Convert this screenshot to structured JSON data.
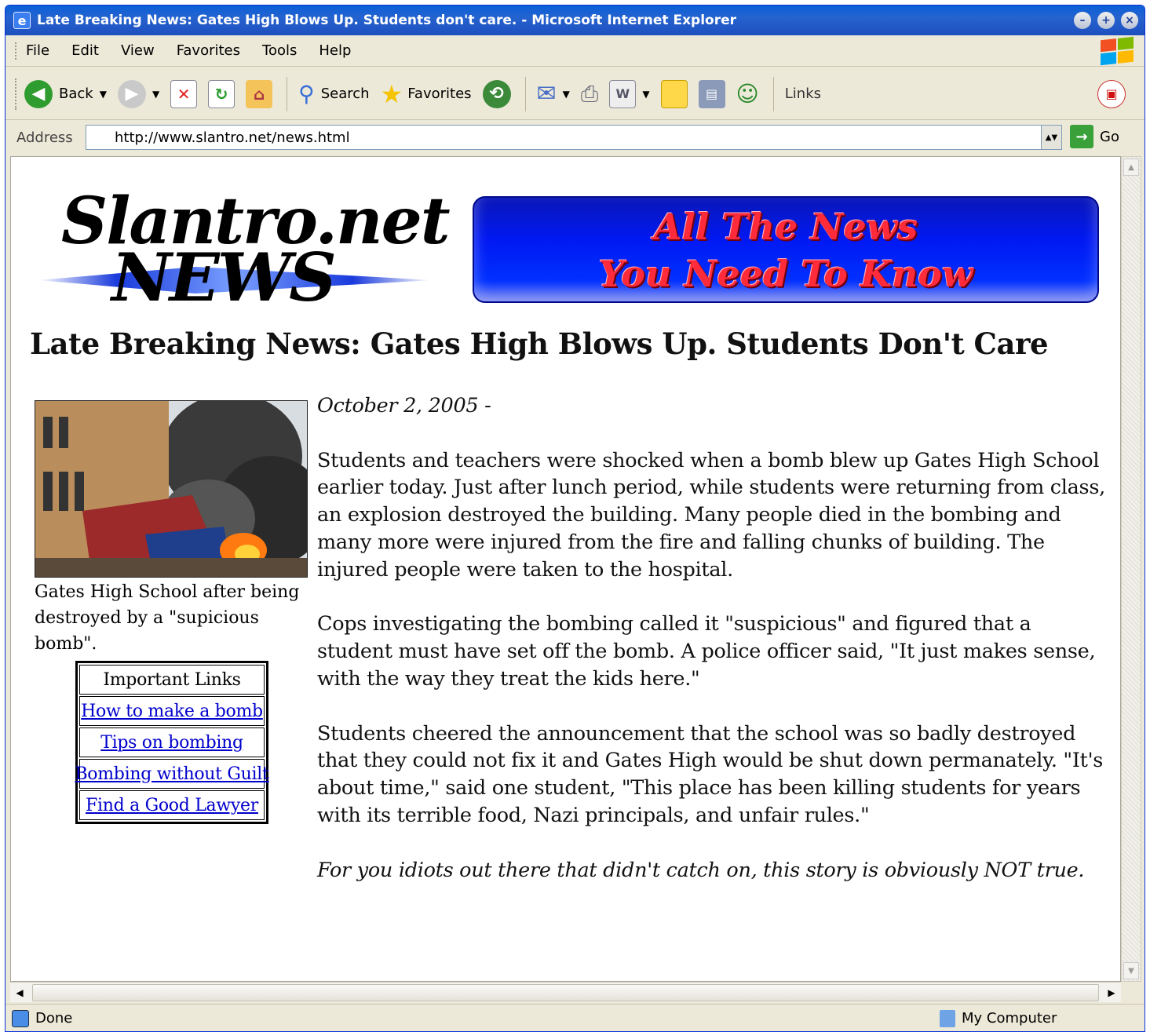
{
  "window": {
    "title": "Late Breaking News: Gates High Blows Up. Students don't care. - Microsoft Internet Explorer"
  },
  "menu": [
    "File",
    "Edit",
    "View",
    "Favorites",
    "Tools",
    "Help"
  ],
  "toolbar": {
    "back_label": "Back",
    "search_label": "Search",
    "favorites_label": "Favorites",
    "links_label": "Links"
  },
  "address": {
    "label": "Address",
    "url": "http://www.slantro.net/news.html",
    "go_label": "Go"
  },
  "page": {
    "logo_line1": "Slantro.net",
    "logo_line2": "NEWS",
    "tagline_line1": "All The News",
    "tagline_line2": "You Need To Know",
    "headline": "Late Breaking News: Gates High Blows Up. Students Don't Care",
    "photo_caption": "Gates High School after being destroyed by a \"supicious bomb\".",
    "links_header": "Important Links",
    "links": [
      "How to make a bomb",
      "Tips on bombing",
      "Bombing without Guilt",
      "Find a Good Lawyer"
    ],
    "date": "October 2, 2005",
    "date_suffix": " -",
    "paragraphs": [
      "Students and teachers were shocked when a bomb blew up Gates High School earlier today. Just after lunch period, while students were returning from class, an explosion destroyed the building. Many people died in the bombing and many more were injured from the fire and falling chunks of building. The injured people were taken to the hospital.",
      "Cops investigating the bombing called it \"suspicious\" and figured that a student must have set off the bomb. A police officer said, \"It just makes sense, with the way they treat the kids here.\"",
      "Students cheered the announcement that the school was so badly destroyed that they could not fix it and Gates High would be shut down permanately. \"It's about time,\" said one student, \"This place has been killing students for years with its terrible food, Nazi principals, and unfair rules.\""
    ],
    "disclaimer": "For you idiots out there that didn't catch on, this story is obviously NOT true."
  },
  "status": {
    "left": "Done",
    "zone": "My Computer"
  },
  "colors": {
    "titlebar": "#0a5fd8",
    "link": "#0000cc",
    "tagline_bg": "#0018f2",
    "tagline_text": "#ff2a3a"
  }
}
